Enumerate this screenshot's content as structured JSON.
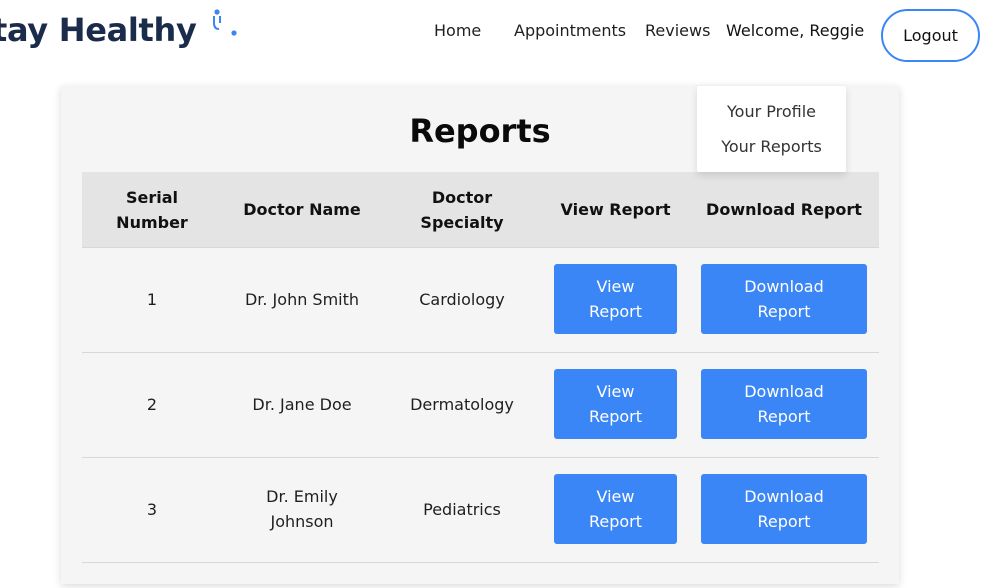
{
  "brand": {
    "name": "tay Healthy"
  },
  "nav": {
    "home": "Home",
    "appointments": "Appointments",
    "reviews": "Reviews",
    "welcome": "Welcome, Reggie",
    "logout": "Logout"
  },
  "dropdown": {
    "profile": "Your Profile",
    "reports": "Your Reports"
  },
  "page": {
    "title": "Reports"
  },
  "table": {
    "headers": [
      "Serial Number",
      "Doctor Name",
      "Doctor Specialty",
      "View Report",
      "Download Report"
    ],
    "rows": [
      {
        "serial": "1",
        "doctor": "Dr. John Smith",
        "specialty": "Cardiology",
        "view": "View Report",
        "download": "Download Report"
      },
      {
        "serial": "2",
        "doctor": "Dr. Jane Doe",
        "specialty": "Dermatology",
        "view": "View Report",
        "download": "Download Report"
      },
      {
        "serial": "3",
        "doctor": "Dr. Emily Johnson",
        "specialty": "Pediatrics",
        "view": "View Report",
        "download": "Download Report"
      }
    ]
  },
  "colors": {
    "accent": "#3a86f6",
    "brand_text": "#1b2b4a",
    "card_bg": "#f5f5f5",
    "header_bg": "#e4e4e4"
  }
}
